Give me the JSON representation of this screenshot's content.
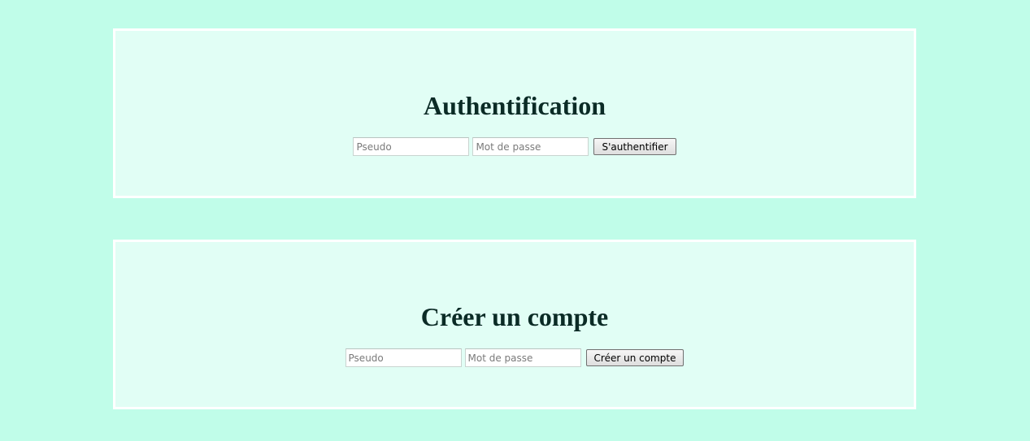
{
  "login": {
    "title": "Authentification",
    "username_placeholder": "Pseudo",
    "password_placeholder": "Mot de passe",
    "submit_label": "S'authentifier"
  },
  "signup": {
    "title": "Créer un compte",
    "username_placeholder": "Pseudo",
    "password_placeholder": "Mot de passe",
    "submit_label": "Créer un compte"
  },
  "colors": {
    "page_background": "#c0fde9",
    "panel_background": "#e1fef5",
    "panel_border": "#ffffff",
    "heading_text": "#0b2b26"
  }
}
